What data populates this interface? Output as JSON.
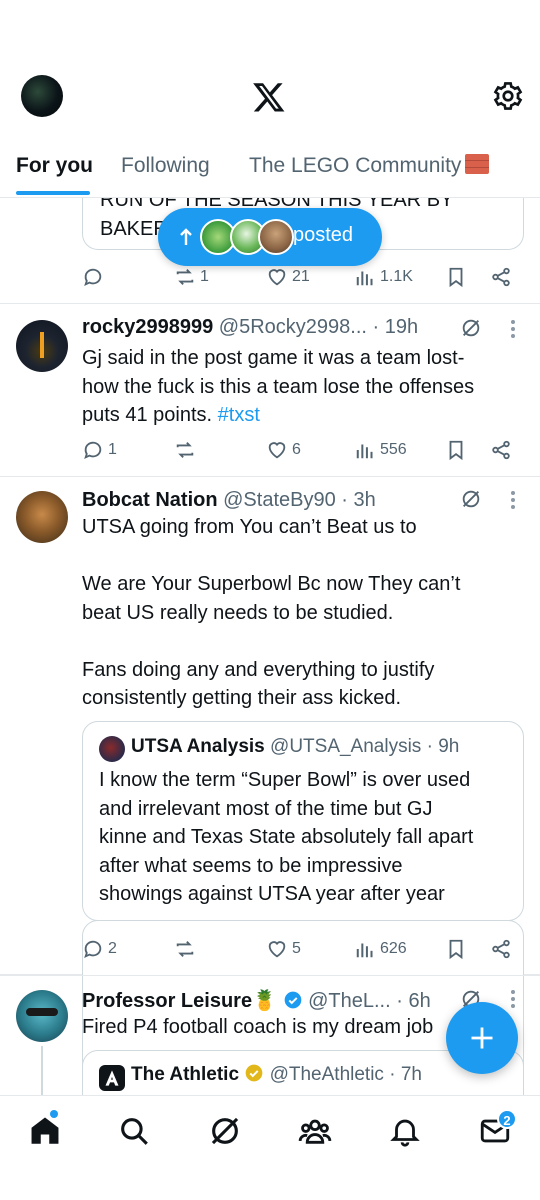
{
  "colors": {
    "accent": "#1d9bf0",
    "text": "#0f1419",
    "secondary": "#536471",
    "border": "#e6e9ec",
    "verified_blue": "#1d9bf0",
    "verified_gold": "#e2b719"
  },
  "header": {
    "tabs": [
      {
        "label": "For you",
        "active": true
      },
      {
        "label": "Following",
        "active": false
      },
      {
        "label": "The LEGO Community",
        "active": false
      }
    ],
    "icons": [
      "avatar",
      "x-logo-icon",
      "gear-icon"
    ]
  },
  "new_posts_pill": {
    "label": "posted",
    "icon": "arrow-up-icon"
  },
  "posts": [
    {
      "partial": true,
      "quote_text_lines": [
        "RUN OF THE SEASON THIS YEAR BY",
        "BAKER"
      ],
      "metrics": {
        "replies": "",
        "reposts": "1",
        "likes": "21",
        "views": "1.1K"
      }
    },
    {
      "name": "rocky2998999",
      "handle": "@5Rocky2998...",
      "time": "· 19h",
      "text_lines": [
        "Gj said in the post game it was a team lost-",
        "how the fuck is this a team lose the offenses",
        "puts 41 points. "
      ],
      "hashtag": "#txst",
      "metrics": {
        "replies": "1",
        "reposts": "",
        "likes": "6",
        "views": "556"
      }
    },
    {
      "name": "Bobcat Nation",
      "handle": "@StateBy90",
      "time": "· 3h",
      "text_lines": [
        "UTSA going from You can’t Beat us to",
        "",
        "We are Your Superbowl Bc now They can’t",
        "beat US really needs to be studied.",
        "",
        "Fans doing any and everything to justify",
        "consistently getting their ass kicked."
      ],
      "quote": {
        "name": "UTSA Analysis",
        "handle": "@UTSA_Analysis",
        "time": "· 9h",
        "text_lines": [
          "I know the term “Super Bowl” is over used",
          "and irrelevant most of the time but GJ",
          "kinne and Texas State absolutely fall apart",
          "after what seems to be impressive",
          "showings against UTSA year after year"
        ]
      },
      "metrics": {
        "replies": "2",
        "reposts": "",
        "likes": "5",
        "views": "626"
      }
    },
    {
      "name": "Professor Leisure",
      "name_emoji": "🍍",
      "handle": "@TheL...",
      "time": "· 6h",
      "text_lines": [
        "Fired P4 football coach is my dream job"
      ],
      "quote": {
        "name": "The Athletic",
        "handle": "@TheAthletic",
        "time": "· 7h"
      }
    }
  ],
  "bottom_nav": {
    "items": [
      "home-icon",
      "search-icon",
      "grok-icon",
      "communities-icon",
      "notifications-icon",
      "messages-icon"
    ],
    "messages_badge": "2"
  },
  "fab": {
    "icon": "plus-icon"
  }
}
